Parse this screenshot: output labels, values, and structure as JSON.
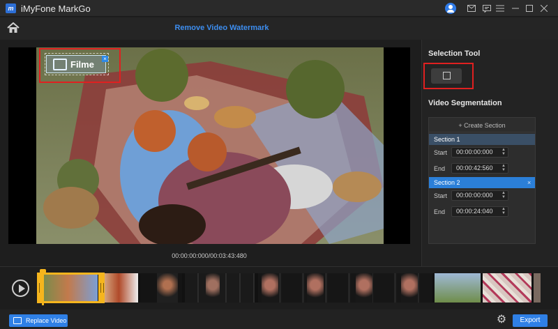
{
  "app": {
    "title": "iMyFone MarkGo",
    "logo_text": "m"
  },
  "header": {
    "title": "Remove Video Watermark"
  },
  "titlebar_icons": [
    "user-avatar-icon",
    "mail-icon",
    "chat-icon",
    "menu-icon",
    "minimize-icon",
    "maximize-icon",
    "close-icon"
  ],
  "video": {
    "watermark_text": "Filme",
    "timecode": "00:00:00:000/00:03:43:480"
  },
  "right_panel": {
    "selection_tool_label": "Selection Tool",
    "video_segmentation_label": "Video Segmentation",
    "create_section_label": "+ Create Section",
    "sections": [
      {
        "name": "Section 1",
        "start_label": "Start",
        "start": "00:00:00:000",
        "end_label": "End",
        "end": "00:00:42:560"
      },
      {
        "name": "Section 2",
        "start_label": "Start",
        "start": "00:00:00:000",
        "end_label": "End",
        "end": "00:00:24:040"
      }
    ]
  },
  "bottom": {
    "replace_label": "Replace Video",
    "export_label": "Export"
  },
  "colors": {
    "accent": "#2f80e6",
    "highlight": "#e02020",
    "range": "#f5b51d"
  }
}
